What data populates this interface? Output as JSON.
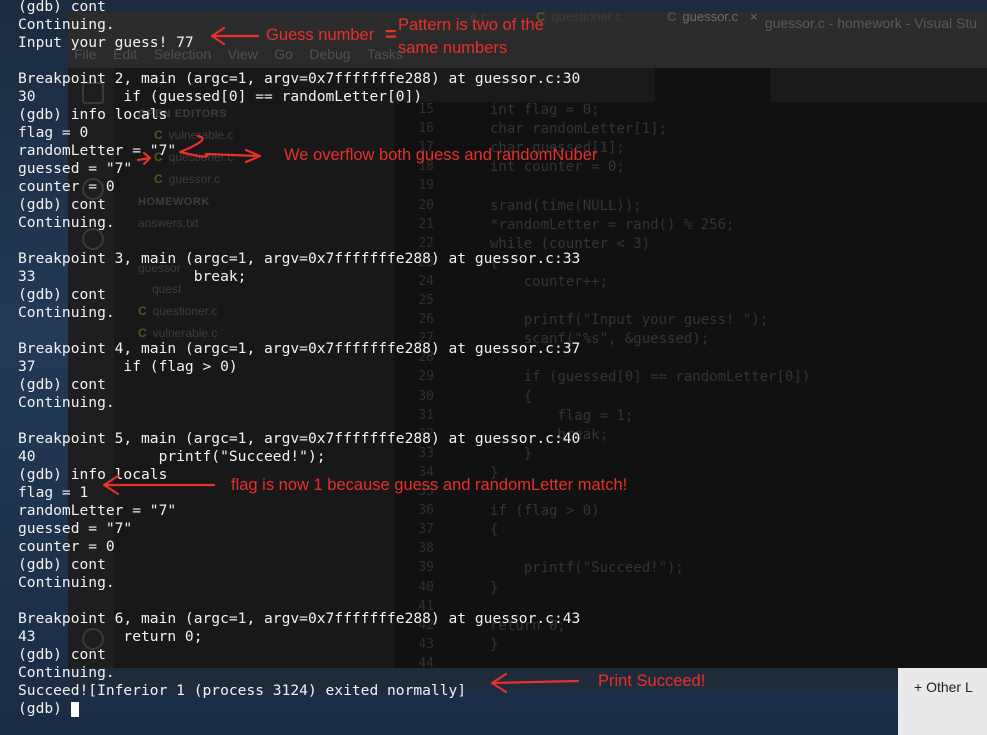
{
  "background_window": {
    "title": "guessor.c - homework - Visual Stu",
    "menu": [
      "File",
      "Edit",
      "Selection",
      "View",
      "Go",
      "Debug",
      "Tasks"
    ],
    "sidebar": {
      "sections": [
        "OPEN EDITORS",
        "HOMEWORK"
      ],
      "open_editors": [
        "vulnerable.c",
        "questioner.c",
        "guessor.c"
      ],
      "homework_files": [
        "answers.txt",
        "guessor",
        "quest",
        "questioner.c",
        "vulnerable.c"
      ]
    },
    "tabs": [
      "e.c",
      "questioner.c",
      "guessor.c"
    ],
    "active_tab_close": "×",
    "line_numbers": [
      "15",
      "16",
      "17",
      "18",
      "19",
      "20",
      "21",
      "22",
      "23",
      "24",
      "25",
      "26",
      "27",
      "28",
      "29",
      "30",
      "31",
      "32",
      "33",
      "34",
      "35",
      "36",
      "37",
      "38",
      "39",
      "40",
      "41",
      "42",
      "43",
      "44"
    ],
    "code_lines": [
      "int flag = 0;",
      "char randomLetter[1];",
      "char guessed[1];",
      "int counter = 0;",
      "",
      "srand(time(NULL));",
      "*randomLetter = rand() % 256;",
      "while (counter < 3)",
      "{",
      "    counter++;",
      "",
      "    printf(\"Input your guess! \");",
      "    scanf(\"%s\", &guessed);",
      "",
      "    if (guessed[0] == randomLetter[0])",
      "    {",
      "        flag = 1;",
      "        break;",
      "    }",
      "}",
      "",
      "if (flag > 0)",
      "{",
      "",
      "    printf(\"Succeed!\");",
      "}",
      "",
      "return 0;",
      "}"
    ],
    "other_panel_label": "Other L"
  },
  "terminal": {
    "lines": [
      "(gdb) cont",
      "Continuing.",
      "Input your guess! 77",
      "",
      "Breakpoint 2, main (argc=1, argv=0x7fffffffe288) at guessor.c:30",
      "30          if (guessed[0] == randomLetter[0])",
      "(gdb) info locals",
      "flag = 0",
      "randomLetter = \"7\"",
      "guessed = \"7\"",
      "counter = 0",
      "(gdb) cont",
      "Continuing.",
      "",
      "Breakpoint 3, main (argc=1, argv=0x7fffffffe288) at guessor.c:33",
      "33                  break;",
      "(gdb) cont",
      "Continuing.",
      "",
      "Breakpoint 4, main (argc=1, argv=0x7fffffffe288) at guessor.c:37",
      "37          if (flag > 0)",
      "(gdb) cont",
      "Continuing.",
      "",
      "Breakpoint 5, main (argc=1, argv=0x7fffffffe288) at guessor.c:40",
      "40              printf(\"Succeed!\");",
      "(gdb) info locals",
      "flag = 1",
      "randomLetter = \"7\"",
      "guessed = \"7\"",
      "counter = 0",
      "(gdb) cont",
      "Continuing.",
      "",
      "Breakpoint 6, main (argc=1, argv=0x7fffffffe288) at guessor.c:43",
      "43          return 0;",
      "(gdb) cont",
      "Continuing.",
      "Succeed![Inferior 1 (process 3124) exited normally]",
      "(gdb) "
    ]
  },
  "annotations": {
    "guess_number": "Guess number",
    "equals_sign": "=",
    "pattern_line1": "Pattern is two of the",
    "pattern_line2": "same numbers",
    "overflow": "We overflow both guess and randomNuber",
    "flag_now": "flag is now 1 because guess and randomLetter match!",
    "print_succeed": "Print Succeed!"
  },
  "colors": {
    "annotation": "#e8302a",
    "terminal_text": "#f2f2f2",
    "terminal_bg": "#0b0b0b"
  }
}
